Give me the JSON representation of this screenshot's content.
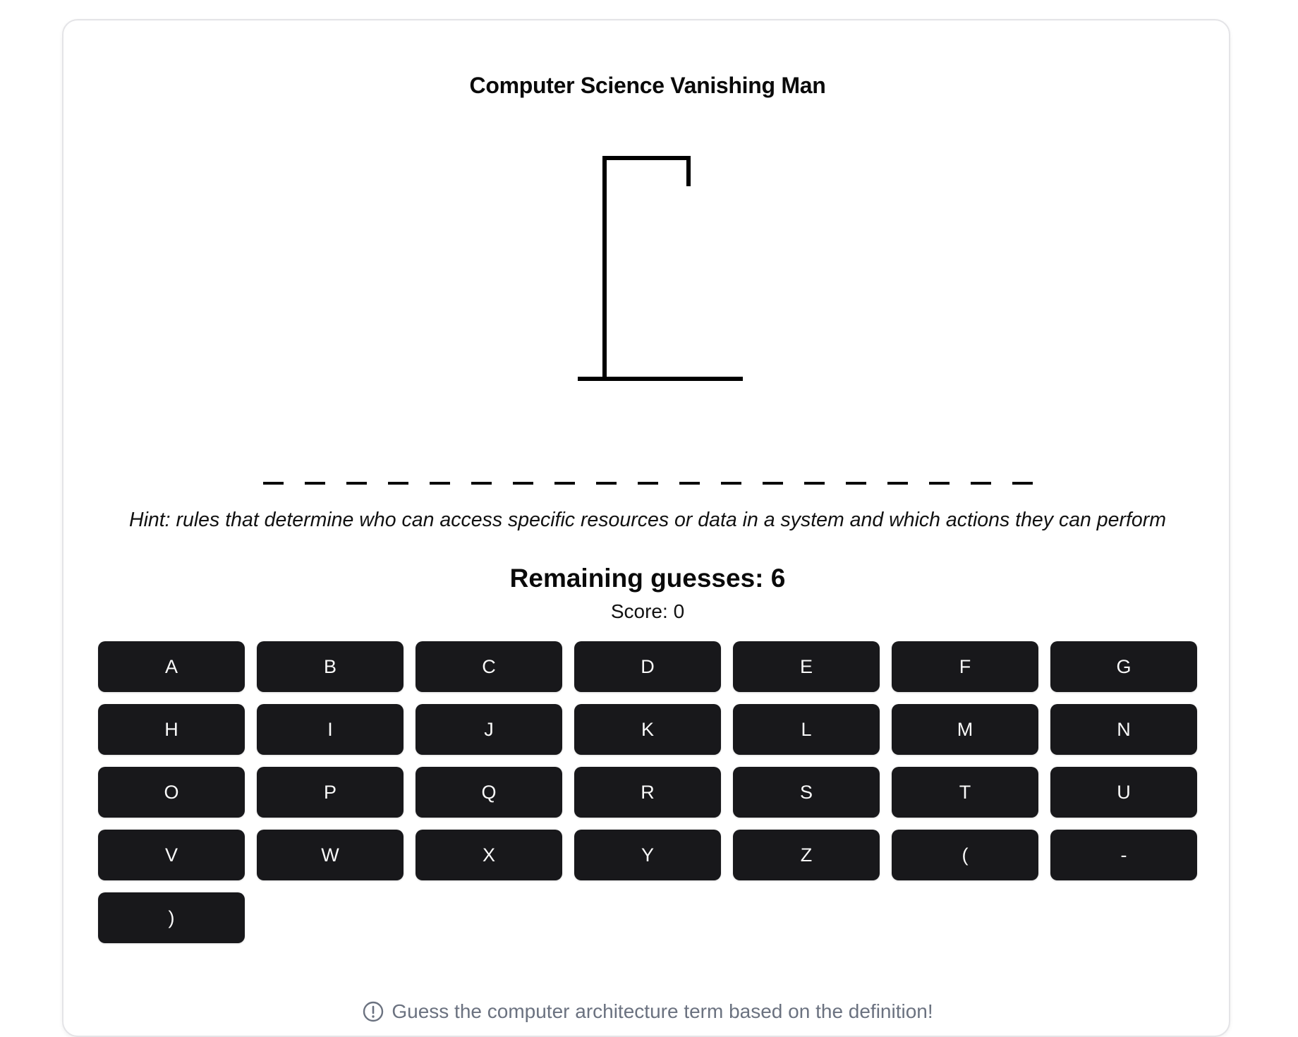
{
  "title": "Computer Science Vanishing Man",
  "word": {
    "blank_count": 19
  },
  "hint": "Hint: rules that determine who can access specific resources or data in a system and which actions they can perform",
  "status": {
    "remaining_label": "Remaining guesses: ",
    "remaining_value": "6",
    "score_label": "Score: ",
    "score_value": "0"
  },
  "keyboard": {
    "keys": [
      "A",
      "B",
      "C",
      "D",
      "E",
      "F",
      "G",
      "H",
      "I",
      "J",
      "K",
      "L",
      "M",
      "N",
      "O",
      "P",
      "Q",
      "R",
      "S",
      "T",
      "U",
      "V",
      "W",
      "X",
      "Y",
      "Z",
      "(",
      "-",
      ")"
    ]
  },
  "footer": {
    "icon": "info-circle-icon",
    "text": "Guess the computer architecture term based on the definition!"
  },
  "colors": {
    "key_background": "#18181b",
    "key_text": "#fafafa",
    "footer_text": "#6b7280",
    "card_border": "#e4e4e7"
  }
}
